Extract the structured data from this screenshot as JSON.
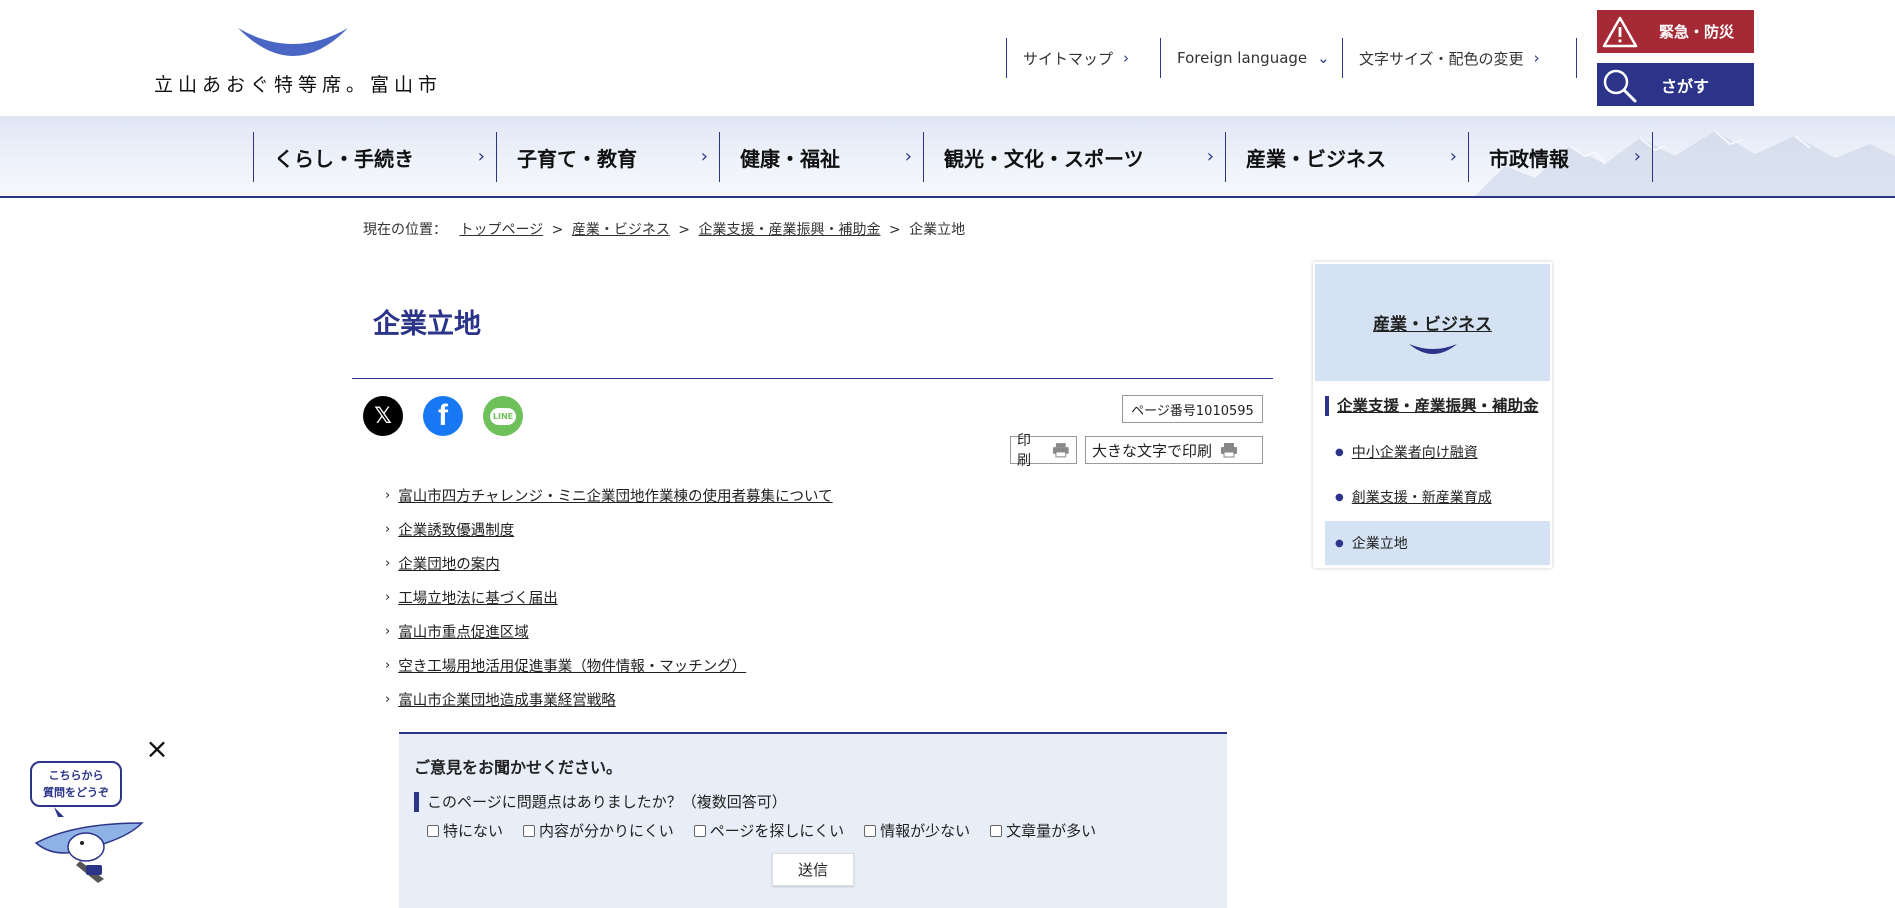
{
  "header": {
    "logo_text": "立山あおぐ特等席。富山市",
    "utility": [
      {
        "label": "サイトマップ",
        "chev": "›"
      },
      {
        "label": "Foreign language",
        "chev": "⌄"
      },
      {
        "label": "文字サイズ・配色の変更",
        "chev": "›"
      }
    ],
    "emergency_label": "緊急・防災",
    "search_label": "さがす"
  },
  "gnav": {
    "items": [
      {
        "label": "くらし・手続き"
      },
      {
        "label": "子育て・教育"
      },
      {
        "label": "健康・福祉"
      },
      {
        "label": "観光・文化・スポーツ"
      },
      {
        "label": "産業・ビジネス"
      },
      {
        "label": "市政情報"
      }
    ],
    "chev": "›"
  },
  "breadcrumb": {
    "prefix": "現在の位置：",
    "items": [
      "トップページ",
      "産業・ビジネス",
      "企業支援・産業振興・補助金"
    ],
    "current": "企業立地",
    "sep": ">"
  },
  "main": {
    "title": "企業立地",
    "page_number": "ページ番号1010595",
    "print_label": "印刷",
    "print_large_label": "大きな文字で印刷",
    "sns": {
      "x": "𝕏",
      "facebook": "f",
      "line": "LINE"
    },
    "links": [
      "富山市四方チャレンジ・ミニ企業団地作業棟の使用者募集について",
      "企業誘致優遇制度",
      "企業団地の案内",
      "工場立地法に基づく届出",
      "富山市重点促進区域",
      "空き工場用地活用促進事業（物件情報・マッチング）",
      "富山市企業団地造成事業経営戦略"
    ]
  },
  "feedback": {
    "title": "ご意見をお聞かせください。",
    "question": "このページに問題点はありましたか？（複数回答可）",
    "options": [
      "特にない",
      "内容が分かりにくい",
      "ページを探しにくい",
      "情報が少ない",
      "文章量が多い"
    ],
    "submit": "送信"
  },
  "side": {
    "heading": "産業・ビジネス",
    "category": "企業支援・産業振興・補助金",
    "items": [
      "中小企業者向け融資",
      "創業支援・新産業育成",
      "企業立地"
    ],
    "active_index": 2
  },
  "chat": {
    "bubble_line1": "こちらから",
    "bubble_line2": "質問をどうぞ",
    "close": "×"
  },
  "colors": {
    "brand": "#2b3489",
    "emergency": "#a52a35",
    "nav_bg": "#dfe6f4",
    "side_head": "#d4e2f3",
    "feedback_bg": "#e8eef8"
  }
}
